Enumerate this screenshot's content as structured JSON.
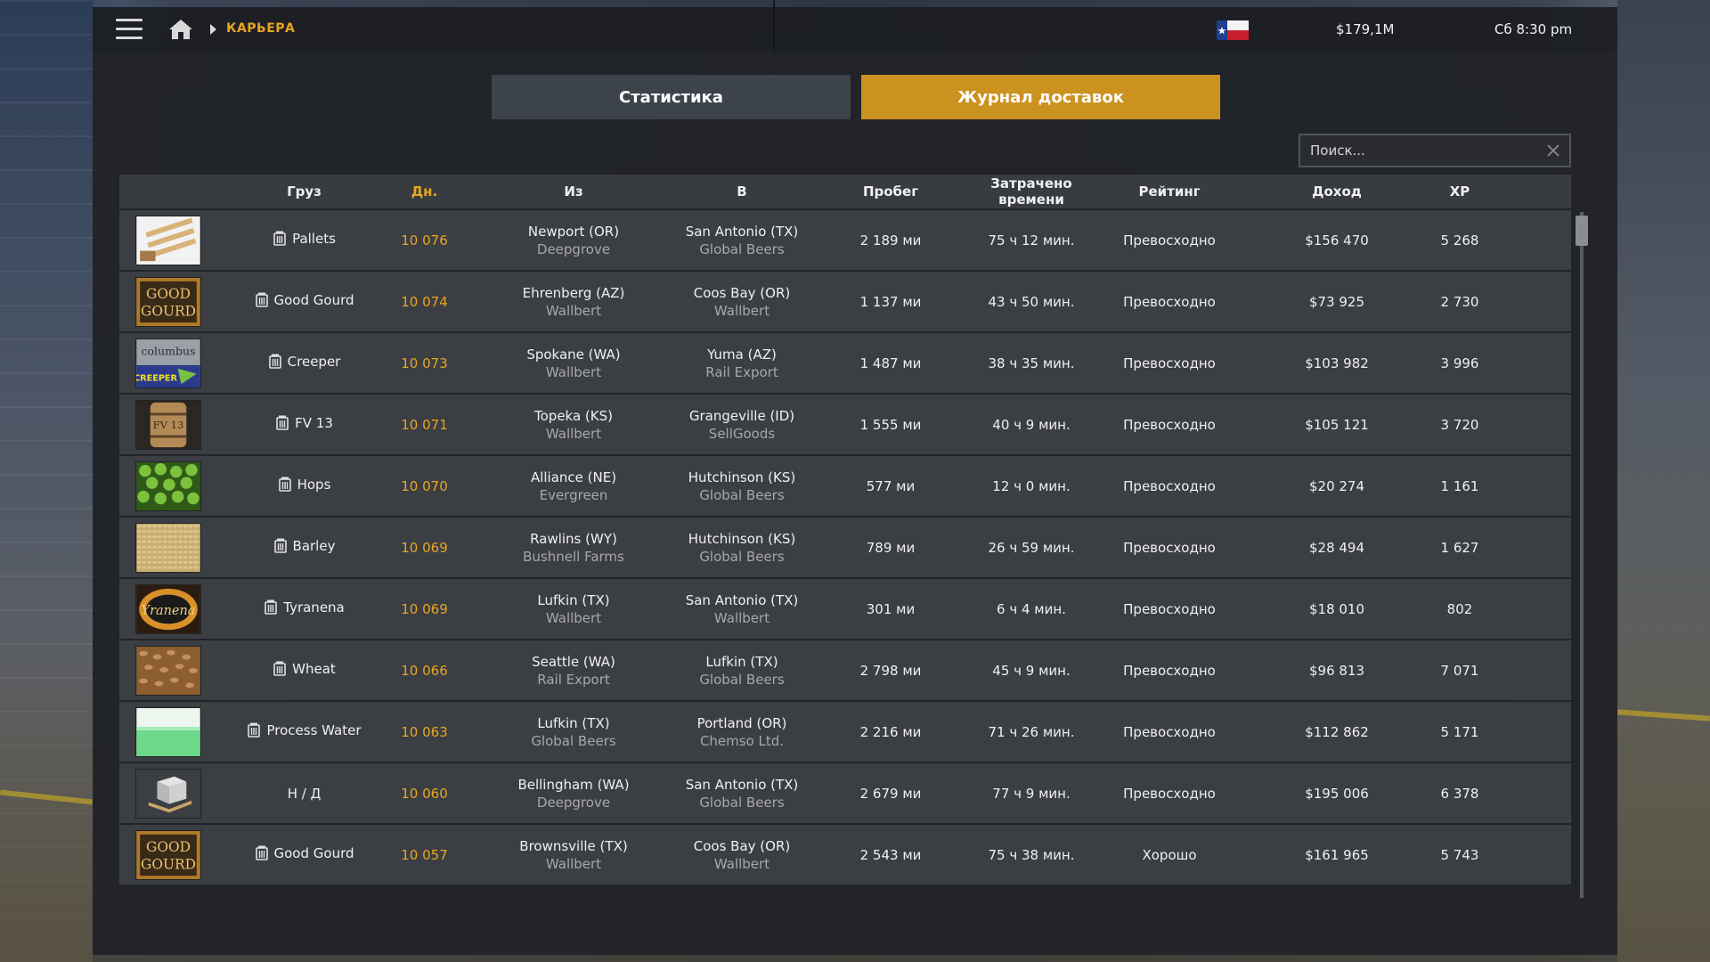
{
  "topbar": {
    "breadcrumb": "КАРЬЕРА",
    "money": "$179,1M",
    "time": "Сб 8:30 pm",
    "icons": {
      "menu": "hamburger-icon",
      "home": "home-icon",
      "flag": "texas-flag-icon"
    }
  },
  "tabs": [
    {
      "label": "Статистика",
      "active": false
    },
    {
      "label": "Журнал доставок",
      "active": true
    }
  ],
  "search": {
    "placeholder": "Поиск..."
  },
  "colors": {
    "accent": "#cc9220",
    "highlight_text": "#e8a620",
    "row_bg": "#3b3e43",
    "header_bg": "#383b40",
    "tab_inactive": "#3c434b"
  },
  "table": {
    "headers": {
      "cargo": "Груз",
      "day": "Дн.",
      "from": "Из",
      "to": "В",
      "distance": "Пробег",
      "time": "Затрачено времени",
      "rating": "Рейтинг",
      "income": "Доход",
      "xp": "XP"
    },
    "rows": [
      {
        "image": "pallets",
        "cargo": "Pallets",
        "icon": "trailer-icon",
        "day": "10 076",
        "from_city": "Newport (OR)",
        "from_company": "Deepgrove",
        "to_city": "San Antonio (TX)",
        "to_company": "Global Beers",
        "distance": "2 189 ми",
        "time": "75 ч 12 мин.",
        "rating": "Превосходно",
        "income": "$156 470",
        "xp": "5 268"
      },
      {
        "image": "good-gourd",
        "cargo": "Good Gourd",
        "icon": "trailer-icon",
        "day": "10 074",
        "from_city": "Ehrenberg (AZ)",
        "from_company": "Wallbert",
        "to_city": "Coos Bay (OR)",
        "to_company": "Wallbert",
        "distance": "1 137 ми",
        "time": "43 ч 50 мин.",
        "rating": "Превосходно",
        "income": "$73 925",
        "xp": "2 730"
      },
      {
        "image": "creeper",
        "cargo": "Creeper",
        "icon": "trailer-icon",
        "day": "10 073",
        "from_city": "Spokane (WA)",
        "from_company": "Wallbert",
        "to_city": "Yuma (AZ)",
        "to_company": "Rail Export",
        "distance": "1 487 ми",
        "time": "38 ч 35 мин.",
        "rating": "Превосходно",
        "income": "$103 982",
        "xp": "3 996"
      },
      {
        "image": "fv13",
        "cargo": "FV 13",
        "icon": "trailer-icon",
        "day": "10 071",
        "from_city": "Topeka (KS)",
        "from_company": "Wallbert",
        "to_city": "Grangeville (ID)",
        "to_company": "SellGoods",
        "distance": "1 555 ми",
        "time": "40 ч 9 мин.",
        "rating": "Превосходно",
        "income": "$105 121",
        "xp": "3 720"
      },
      {
        "image": "hops",
        "cargo": "Hops",
        "icon": "trailer-icon",
        "day": "10 070",
        "from_city": "Alliance (NE)",
        "from_company": "Evergreen",
        "to_city": "Hutchinson (KS)",
        "to_company": "Global Beers",
        "distance": "577 ми",
        "time": "12 ч 0 мин.",
        "rating": "Превосходно",
        "income": "$20 274",
        "xp": "1 161"
      },
      {
        "image": "barley",
        "cargo": "Barley",
        "icon": "trailer-icon",
        "day": "10 069",
        "from_city": "Rawlins (WY)",
        "from_company": "Bushnell Farms",
        "to_city": "Hutchinson (KS)",
        "to_company": "Global Beers",
        "distance": "789 ми",
        "time": "26 ч 59 мин.",
        "rating": "Превосходно",
        "income": "$28 494",
        "xp": "1 627"
      },
      {
        "image": "tyranena",
        "cargo": "Tyranena",
        "icon": "trailer-icon",
        "day": "10 069",
        "from_city": "Lufkin (TX)",
        "from_company": "Wallbert",
        "to_city": "San Antonio (TX)",
        "to_company": "Wallbert",
        "distance": "301 ми",
        "time": "6 ч 4 мин.",
        "rating": "Превосходно",
        "income": "$18 010",
        "xp": "802"
      },
      {
        "image": "wheat",
        "cargo": "Wheat",
        "icon": "trailer-icon",
        "day": "10 066",
        "from_city": "Seattle (WA)",
        "from_company": "Rail Export",
        "to_city": "Lufkin (TX)",
        "to_company": "Global Beers",
        "distance": "2 798 ми",
        "time": "45 ч 9 мин.",
        "rating": "Превосходно",
        "income": "$96 813",
        "xp": "7 071"
      },
      {
        "image": "process-water",
        "cargo": "Process Water",
        "icon": "trailer-icon",
        "day": "10 063",
        "from_city": "Lufkin (TX)",
        "from_company": "Global Beers",
        "to_city": "Portland (OR)",
        "to_company": "Chemso Ltd.",
        "distance": "2 216 ми",
        "time": "71 ч 26 мин.",
        "rating": "Превосходно",
        "income": "$112 862",
        "xp": "5 171"
      },
      {
        "image": "crate",
        "cargo": "Н / Д",
        "icon": "",
        "day": "10 060",
        "from_city": "Bellingham (WA)",
        "from_company": "Deepgrove",
        "to_city": "San Antonio (TX)",
        "to_company": "Global Beers",
        "distance": "2 679 ми",
        "time": "77 ч 9 мин.",
        "rating": "Превосходно",
        "income": "$195 006",
        "xp": "6 378"
      },
      {
        "image": "good-gourd",
        "cargo": "Good Gourd",
        "icon": "trailer-icon",
        "day": "10 057",
        "from_city": "Brownsville (TX)",
        "from_company": "Wallbert",
        "to_city": "Coos Bay (OR)",
        "to_company": "Wallbert",
        "distance": "2 543 ми",
        "time": "75 ч 38 мин.",
        "rating": "Хорошо",
        "income": "$161 965",
        "xp": "5 743"
      }
    ]
  }
}
